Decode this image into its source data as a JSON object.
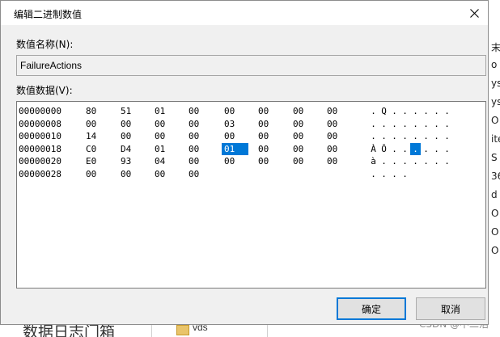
{
  "dialog": {
    "title": "编辑二进制数值",
    "name_label": "数值名称(N):",
    "name_value": "FailureActions",
    "data_label": "数值数据(V):",
    "ok_label": "确定",
    "cancel_label": "取消",
    "selected_byte": {
      "row": 3,
      "col": 4
    },
    "accent_color": "#0078d7"
  },
  "hex_rows": [
    {
      "offset": "00000000",
      "bytes": [
        "80",
        "51",
        "01",
        "00",
        "00",
        "00",
        "00",
        "00"
      ],
      "ascii": [
        ".",
        "Q",
        ".",
        ".",
        ".",
        ".",
        ".",
        "."
      ]
    },
    {
      "offset": "00000008",
      "bytes": [
        "00",
        "00",
        "00",
        "00",
        "03",
        "00",
        "00",
        "00"
      ],
      "ascii": [
        ".",
        ".",
        ".",
        ".",
        ".",
        ".",
        ".",
        "."
      ]
    },
    {
      "offset": "00000010",
      "bytes": [
        "14",
        "00",
        "00",
        "00",
        "00",
        "00",
        "00",
        "00"
      ],
      "ascii": [
        ".",
        ".",
        ".",
        ".",
        ".",
        ".",
        ".",
        "."
      ]
    },
    {
      "offset": "00000018",
      "bytes": [
        "C0",
        "D4",
        "01",
        "00",
        "01",
        "00",
        "00",
        "00"
      ],
      "ascii": [
        "À",
        "Ô",
        ".",
        ".",
        ".",
        ".",
        ".",
        "."
      ]
    },
    {
      "offset": "00000020",
      "bytes": [
        "E0",
        "93",
        "04",
        "00",
        "00",
        "00",
        "00",
        "00"
      ],
      "ascii": [
        "à",
        ".",
        ".",
        ".",
        ".",
        ".",
        ".",
        "."
      ]
    },
    {
      "offset": "00000028",
      "bytes": [
        "00",
        "00",
        "00",
        "00"
      ],
      "ascii": [
        ".",
        ".",
        ".",
        "."
      ]
    }
  ],
  "background": {
    "right_fragments": [
      "末",
      "o",
      "ys",
      "ys",
      "O",
      "ite",
      "S",
      "36",
      "d",
      "O",
      "O",
      "O"
    ],
    "bottom_text": "数据日志门箱",
    "folder_label": "vds",
    "watermark": "CSDN @中二活"
  }
}
